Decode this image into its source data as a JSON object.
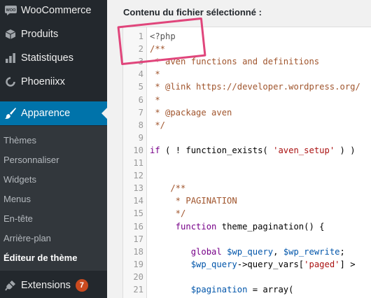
{
  "sidebar": {
    "items": [
      {
        "id": "woo",
        "label": "WooCommerce",
        "icon": "woo-icon"
      },
      {
        "id": "products",
        "label": "Produits",
        "icon": "box-icon"
      },
      {
        "id": "stats",
        "label": "Statistiques",
        "icon": "bar-chart-icon"
      },
      {
        "id": "phoenix",
        "label": "Phoeniixx",
        "icon": "circle-icon"
      },
      {
        "id": "appearance",
        "label": "Apparence",
        "icon": "paintbrush-icon",
        "active": true
      }
    ],
    "submenu": [
      {
        "label": "Thèmes"
      },
      {
        "label": "Personnaliser"
      },
      {
        "label": "Widgets"
      },
      {
        "label": "Menus"
      },
      {
        "label": "En-tête"
      },
      {
        "label": "Arrière-plan"
      },
      {
        "label": "Éditeur de thème",
        "current": true
      }
    ],
    "extensions": {
      "label": "Extensions",
      "icon": "plug-icon",
      "badge": "7"
    }
  },
  "content": {
    "label": "Contenu du fichier sélectionné :"
  },
  "editor": {
    "lines": [
      {
        "n": "1",
        "tokens": [
          {
            "t": "<?php",
            "c": "tag"
          }
        ]
      },
      {
        "n": "2",
        "tokens": [
          {
            "t": "/**",
            "c": "comment"
          }
        ]
      },
      {
        "n": "3",
        "tokens": [
          {
            "t": " * aven functions and definitions",
            "c": "comment"
          }
        ]
      },
      {
        "n": "4",
        "tokens": [
          {
            "t": " *",
            "c": "comment"
          }
        ]
      },
      {
        "n": "5",
        "tokens": [
          {
            "t": " * @link https://developer.wordpress.org/",
            "c": "comment"
          }
        ]
      },
      {
        "n": "6",
        "tokens": [
          {
            "t": " *",
            "c": "comment"
          }
        ]
      },
      {
        "n": "7",
        "tokens": [
          {
            "t": " * @package aven",
            "c": "comment"
          }
        ]
      },
      {
        "n": "8",
        "tokens": [
          {
            "t": " */",
            "c": "comment"
          }
        ]
      },
      {
        "n": "9",
        "tokens": []
      },
      {
        "n": "10",
        "tokens": [
          {
            "t": "if",
            "c": "keyword"
          },
          {
            "t": " ( ! function_exists( ",
            "c": "plain"
          },
          {
            "t": "'aven_setup'",
            "c": "string"
          },
          {
            "t": " ) )",
            "c": "plain"
          }
        ]
      },
      {
        "n": "11",
        "tokens": []
      },
      {
        "n": "12",
        "tokens": []
      },
      {
        "n": "13",
        "tokens": [
          {
            "t": "    /**",
            "c": "comment"
          }
        ]
      },
      {
        "n": "14",
        "tokens": [
          {
            "t": "     * PAGINATION",
            "c": "comment"
          }
        ]
      },
      {
        "n": "15",
        "tokens": [
          {
            "t": "     */",
            "c": "comment"
          }
        ]
      },
      {
        "n": "16",
        "tokens": [
          {
            "t": "     ",
            "c": "plain"
          },
          {
            "t": "function",
            "c": "keyword"
          },
          {
            "t": " theme_pagination() {",
            "c": "plain"
          }
        ]
      },
      {
        "n": "17",
        "tokens": []
      },
      {
        "n": "18",
        "tokens": [
          {
            "t": "        ",
            "c": "plain"
          },
          {
            "t": "global",
            "c": "keyword"
          },
          {
            "t": " ",
            "c": "plain"
          },
          {
            "t": "$wp_query",
            "c": "var"
          },
          {
            "t": ", ",
            "c": "plain"
          },
          {
            "t": "$wp_rewrite",
            "c": "var"
          },
          {
            "t": ";",
            "c": "plain"
          }
        ]
      },
      {
        "n": "19",
        "tokens": [
          {
            "t": "        ",
            "c": "plain"
          },
          {
            "t": "$wp_query",
            "c": "var"
          },
          {
            "t": "->query_vars[",
            "c": "plain"
          },
          {
            "t": "'paged'",
            "c": "string"
          },
          {
            "t": "] >",
            "c": "plain"
          }
        ]
      },
      {
        "n": "20",
        "tokens": []
      },
      {
        "n": "21",
        "tokens": [
          {
            "t": "        ",
            "c": "plain"
          },
          {
            "t": "$pagination",
            "c": "var"
          },
          {
            "t": " = array(",
            "c": "plain"
          }
        ]
      }
    ]
  },
  "colors": {
    "sidebar_bg": "#23282d",
    "submenu_bg": "#32373c",
    "active_bg": "#0073aa",
    "badge_bg": "#ca4a1f",
    "highlight": "#e0457b"
  }
}
